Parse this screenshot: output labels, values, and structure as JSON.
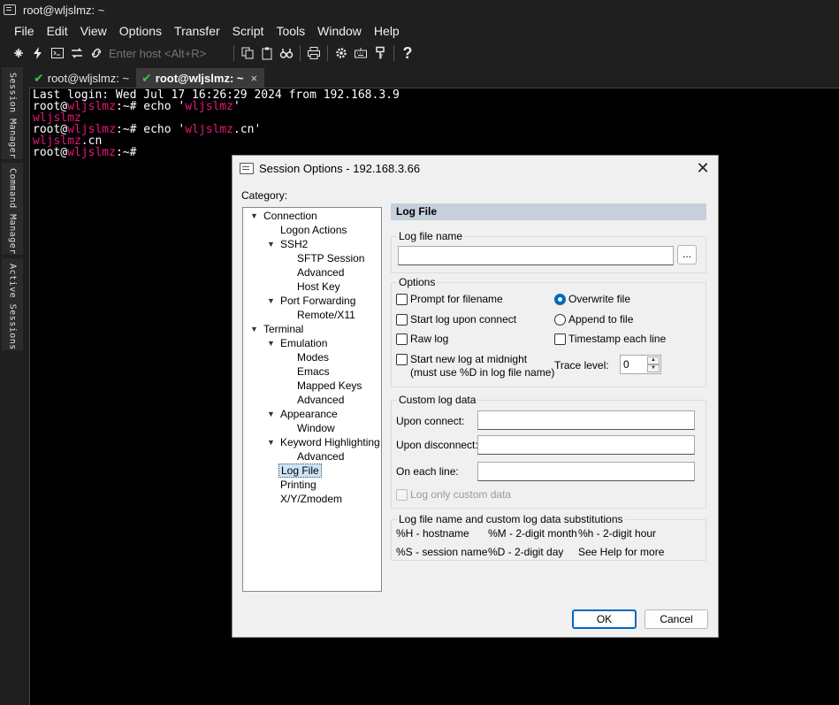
{
  "window": {
    "title": "root@wljslmz: ~"
  },
  "menu": [
    "File",
    "Edit",
    "View",
    "Options",
    "Transfer",
    "Script",
    "Tools",
    "Window",
    "Help"
  ],
  "toolbar": {
    "host_placeholder": "Enter host <Alt+R>",
    "icons": [
      "connect-icon",
      "quick-connect-icon",
      "session-tab-icon",
      "reconnect-icon",
      "disconnect-icon",
      "copy-icon",
      "paste-icon",
      "find-icon",
      "print-icon",
      "settings-icon",
      "keymap-icon",
      "key-icon",
      "help-icon"
    ]
  },
  "side_tabs": [
    "Session Manager",
    "Command Manager",
    "Active Sessions"
  ],
  "tabs": [
    {
      "label": "root@wljslmz: ~",
      "active": false
    },
    {
      "label": "root@wljslmz: ~",
      "active": true,
      "close": "×"
    }
  ],
  "terminal": {
    "line1": "Last login: Wed Jul 17 16:26:29 2024 from 192.168.3.9",
    "prompt_user": "root@",
    "prompt_host": "wljslmz",
    "prompt_tail": ":~# ",
    "cmd1_pre": "echo '",
    "cmd1_arg": "wljslmz",
    "cmd1_post": "'",
    "out1": "wljslmz",
    "cmd2_pre": "echo '",
    "cmd2_arg": "wljslmz",
    "cmd2_arg_tail": ".cn",
    "cmd2_post": "'",
    "out2_a": "wljslmz",
    "out2_b": ".cn"
  },
  "dialog": {
    "title": "Session Options - 192.168.3.66",
    "close": "✕",
    "category_label": "Category:",
    "tree": [
      {
        "label": "Connection",
        "arrow": true
      },
      {
        "label": "Logon Actions"
      },
      {
        "label": "SSH2",
        "arrow": true
      },
      {
        "label": "SFTP Session"
      },
      {
        "label": "Advanced"
      },
      {
        "label": "Host Key"
      },
      {
        "label": "Port Forwarding",
        "arrow": true
      },
      {
        "label": "Remote/X11"
      },
      {
        "label": "Terminal",
        "arrow": true
      },
      {
        "label": "Emulation",
        "arrow": true
      },
      {
        "label": "Modes"
      },
      {
        "label": "Emacs"
      },
      {
        "label": "Mapped Keys"
      },
      {
        "label": "Advanced"
      },
      {
        "label": "Appearance",
        "arrow": true
      },
      {
        "label": "Window"
      },
      {
        "label": "Keyword Highlighting",
        "arrow": true
      },
      {
        "label": "Advanced"
      },
      {
        "label": "Log File",
        "selected": true
      },
      {
        "label": "Printing"
      },
      {
        "label": "X/Y/Zmodem"
      }
    ],
    "panel_title": "Log File",
    "log_file_name_label": "Log file name",
    "log_file_name_value": "",
    "browse_label": "...",
    "options_label": "Options",
    "opt_prompt": "Prompt for filename",
    "opt_start_upon_connect": "Start log upon connect",
    "opt_raw": "Raw log",
    "opt_midnight": "Start new log at midnight",
    "opt_midnight_note": "(must use %D in log file name)",
    "opt_overwrite": "Overwrite file",
    "opt_append": "Append to file",
    "opt_timestamp": "Timestamp each line",
    "trace_label": "Trace level:",
    "trace_value": "0",
    "custom_label": "Custom log data",
    "upon_connect_label": "Upon connect:",
    "upon_disconnect_label": "Upon disconnect:",
    "each_line_label": "On each line:",
    "log_only_custom": "Log only custom data",
    "subst_label": "Log file name and custom log data substitutions",
    "subst": [
      "%H - hostname",
      "%M - 2-digit month",
      "%h - 2-digit hour",
      "%S - session name",
      "%D - 2-digit day",
      "See Help for more"
    ],
    "ok_label": "OK",
    "cancel_label": "Cancel"
  }
}
